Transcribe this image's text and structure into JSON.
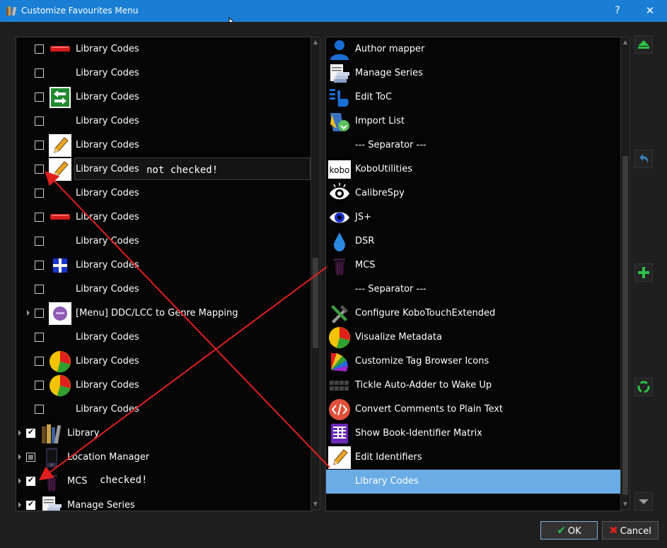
{
  "window": {
    "title": "Customize Favourites Menu",
    "help_glyph": "?",
    "close_glyph": "✕"
  },
  "annotations": {
    "not_checked": "not checked!",
    "checked": "checked!"
  },
  "left_list": [
    {
      "label": "Library Codes",
      "icon": "red-bar-icon"
    },
    {
      "label": "Library Codes",
      "icon": ""
    },
    {
      "label": "Library Codes",
      "icon": "green-arrows-icon"
    },
    {
      "label": "Library Codes",
      "icon": ""
    },
    {
      "label": "Library Codes",
      "icon": "pencil-icon"
    },
    {
      "label": "Library Codes",
      "icon": "pencil-icon"
    },
    {
      "label": "Library Codes",
      "icon": ""
    },
    {
      "label": "Library Codes",
      "icon": "red-bar-icon"
    },
    {
      "label": "Library Codes",
      "icon": ""
    },
    {
      "label": "Library Codes",
      "icon": "blue-cross-icon"
    },
    {
      "label": "Library Codes",
      "icon": ""
    },
    {
      "label": "[Menu] DDC/LCC to Genre Mapping",
      "icon": "purple-circle-icon"
    },
    {
      "label": "Library Codes",
      "icon": ""
    },
    {
      "label": "Library Codes",
      "icon": "pie-chart-icon"
    },
    {
      "label": "Library Codes",
      "icon": "pie-chart-icon"
    },
    {
      "label": "Library Codes",
      "icon": ""
    },
    {
      "label": "Library",
      "icon": "books-icon"
    },
    {
      "label": "Location Manager",
      "icon": "device-icon"
    },
    {
      "label": "MCS",
      "icon": "trash-icon"
    },
    {
      "label": "Manage Series",
      "icon": "series-icon"
    }
  ],
  "right_list": [
    {
      "label": "Author mapper",
      "icon": "person-icon"
    },
    {
      "label": "Manage Series",
      "icon": "series-icon"
    },
    {
      "label": "Edit ToC",
      "icon": "toc-icon"
    },
    {
      "label": "Import List",
      "icon": "import-icon"
    },
    {
      "label": "--- Separator ---",
      "icon": ""
    },
    {
      "label": "KoboUtilities",
      "icon": "kobo-icon"
    },
    {
      "label": "CalibreSpy",
      "icon": "eye-icon"
    },
    {
      "label": "JS+",
      "icon": "blue-eye-icon"
    },
    {
      "label": "DSR",
      "icon": "droplet-icon"
    },
    {
      "label": "MCS",
      "icon": "trash-icon"
    },
    {
      "label": "--- Separator ---",
      "icon": ""
    },
    {
      "label": "Configure KoboTouchExtended",
      "icon": "tools-icon"
    },
    {
      "label": "Visualize Metadata",
      "icon": "pie-chart-icon"
    },
    {
      "label": "Customize Tag Browser Icons",
      "icon": "color-fan-icon"
    },
    {
      "label": "Tickle Auto-Adder to Wake Up",
      "icon": "keyboard-icon"
    },
    {
      "label": "Convert Comments to Plain Text",
      "icon": "code-icon"
    },
    {
      "label": "Show Book-Identifier Matrix",
      "icon": "matrix-icon"
    },
    {
      "label": "Edit Identifiers",
      "icon": "pencil-icon"
    },
    {
      "label": "Library Codes",
      "icon": ""
    }
  ],
  "buttons": {
    "ok": "OK",
    "cancel": "Cancel"
  },
  "colors": {
    "titlebar": "#1a7fd4",
    "selection": "#6aace6",
    "arrow": "#e0201c",
    "side_button_green": "#2fbf4a"
  }
}
